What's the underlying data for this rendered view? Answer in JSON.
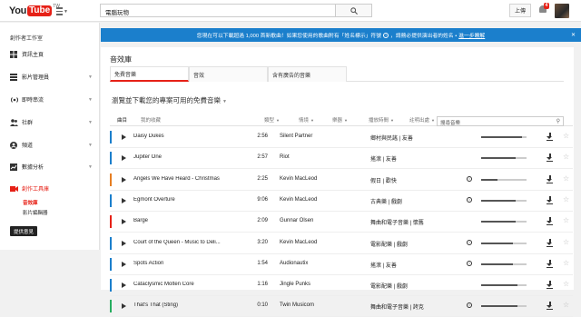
{
  "masthead": {
    "logo_you": "You",
    "logo_tube": "Tube",
    "logo_region": "TW",
    "search_value": "電腦玩物",
    "upload_label": "上傳",
    "notification_count": "4"
  },
  "sidebar": {
    "title": "創作者工作室",
    "items": [
      {
        "label": "資訊主頁",
        "icon": "dashboard-icon"
      },
      {
        "label": "影片管理員",
        "icon": "video-manager-icon"
      },
      {
        "label": "即時串流",
        "icon": "live-stream-icon"
      },
      {
        "label": "社群",
        "icon": "community-icon"
      },
      {
        "label": "頻道",
        "icon": "channel-icon"
      },
      {
        "label": "數據分析",
        "icon": "analytics-icon"
      },
      {
        "label": "創作工具庫",
        "icon": "create-icon"
      }
    ],
    "sub_items": [
      {
        "label": "音效庫"
      },
      {
        "label": "影片編輯器"
      }
    ],
    "feedback_label": "提供意見"
  },
  "banner": {
    "text_before_icon": "您現在可以下載超過 1,000 首新歌曲！如果您使用的歌曲附有「姓名標示」符號",
    "text_after_icon": "，請務必提供演出者的姓名 •",
    "link": "進一步瞭解",
    "close": "✕"
  },
  "main": {
    "page_title": "音效庫",
    "tabs": [
      {
        "label": "免費音樂",
        "active": true
      },
      {
        "label": "音效"
      },
      {
        "label": "含有廣告的音樂"
      }
    ],
    "subtitle": "瀏覽並下載您的專案可用的免費音樂",
    "filter_tabs": [
      {
        "label": "曲目",
        "active": true
      },
      {
        "label": "我的收藏"
      }
    ],
    "filter_dropdowns": [
      {
        "label": "類型"
      },
      {
        "label": "情境"
      },
      {
        "label": "樂器"
      },
      {
        "label": "播放時間"
      },
      {
        "label": "註明出處"
      }
    ],
    "search_placeholder": "搜尋音樂"
  },
  "tracks": [
    {
      "title": "Daisy Dukes",
      "duration": "2:56",
      "artist": "Silent Partner",
      "genre": "鄉村與民謠 | 友善",
      "attribution": false,
      "popularity": 0.9,
      "color": "#1b7fcc"
    },
    {
      "title": "Jupiter One",
      "duration": "2:57",
      "artist": "Riot",
      "genre": "搖滾 | 友善",
      "attribution": false,
      "popularity": 0.75,
      "color": "#1b7fcc"
    },
    {
      "title": "Angels We Have Heard - Christmas",
      "duration": "2:25",
      "artist": "Kevin MacLeod",
      "genre": "假日 | 歡快",
      "attribution": true,
      "popularity": 0.35,
      "color": "#e67e22"
    },
    {
      "title": "Egmont Overture",
      "duration": "9:06",
      "artist": "Kevin MacLeod",
      "genre": "古典樂 | 戲劇",
      "attribution": true,
      "popularity": 0.75,
      "color": "#1b7fcc"
    },
    {
      "title": "Barge",
      "duration": "2:09",
      "artist": "Gunnar Olsen",
      "genre": "舞曲和電子音樂 | 懷舊",
      "attribution": false,
      "popularity": 0.75,
      "color": "#e62117"
    },
    {
      "title": "Court of the Queen - Music to Deli...",
      "duration": "3:20",
      "artist": "Kevin MacLeod",
      "genre": "電影配樂 | 戲劇",
      "attribution": true,
      "popularity": 0.7,
      "color": "#1b7fcc"
    },
    {
      "title": "Spots Action",
      "duration": "1:54",
      "artist": "Audionautix",
      "genre": "搖滾 | 友善",
      "attribution": true,
      "popularity": 0.7,
      "color": "#1b7fcc"
    },
    {
      "title": "Cataclysmic Molten Core",
      "duration": "1:16",
      "artist": "Jingle Punks",
      "genre": "電影配樂 | 戲劇",
      "attribution": false,
      "popularity": 0.8,
      "color": "#1b7fcc"
    },
    {
      "title": "That's That (Sting)",
      "duration": "0:10",
      "artist": "Twin Musicom",
      "genre": "舞曲和電子音樂 | 誇克",
      "attribution": true,
      "popularity": 0.8,
      "color": "#27ae60"
    }
  ]
}
